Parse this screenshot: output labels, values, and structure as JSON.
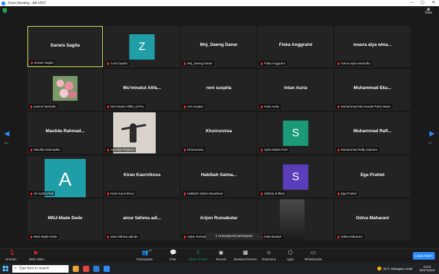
{
  "window": {
    "title": "Zoom Meeting - AA-VIII/7",
    "min": "—",
    "max": "▢",
    "close": "✕"
  },
  "topbar": {
    "view_label": "View",
    "view_icon": "grid"
  },
  "navigation": {
    "left_page": "1/2",
    "right_page": "1/2",
    "left_arrow": "◀",
    "right_arrow": "▶"
  },
  "tiles": [
    {
      "name": "Darwis Sagita",
      "label": "Darwis Sagita",
      "active": true
    },
    {
      "avatar": "Z",
      "avatar_color": "#1f9ea8",
      "label": "zoom baa04"
    },
    {
      "name": "Mnj_Daeng Danar",
      "label": "Mnj_Daeng Danar"
    },
    {
      "name": "Fiska Anggraini",
      "label": "Fiska Anggraini"
    },
    {
      "name": "maura alya wina...",
      "label": "maura alya winandha"
    },
    {
      "photo": "flowers",
      "label": "yasmin hamidah"
    },
    {
      "name": "Mu'minatul Alifa...",
      "label": "Mu'minatul Alifah_ILPOL"
    },
    {
      "name": "reni suspita",
      "label": "reni suspita"
    },
    {
      "name": "Intan Auria",
      "label": "Intan Auria"
    },
    {
      "name": "Muhammad Eka...",
      "label": "Muhammad Eka Nanda Putra Naser"
    },
    {
      "name": "Maulida Rahmad...",
      "label": "Maulida Rahmadini"
    },
    {
      "photo": "dance",
      "label": "Ayu Dwi Pratama"
    },
    {
      "name": "Khoirunnisa",
      "label": "Khoirunnisa"
    },
    {
      "avatar": "S",
      "avatar_color": "#1a9a78",
      "label": "Syifa Maitra Putri"
    },
    {
      "name": "Muhammad Rafl...",
      "label": "Muhammad Rafly Diantoro"
    },
    {
      "avatar": "A",
      "avatar_color": "#1f9ea8",
      "big": true,
      "label": "Afi Aprilia Putri"
    },
    {
      "name": "Kiran Kaurnikova",
      "label": "Kiran Kaurnikova"
    },
    {
      "name": "Habibah Salma...",
      "label": "Habibah Salma Banahsan"
    },
    {
      "avatar": "S",
      "avatar_color": "#5a3db8",
      "label": "Safrida Zulfiani"
    },
    {
      "name": "Ega Pratiwi",
      "label": "Ega Pratiwi"
    },
    {
      "name": "MNJ-Made Dede",
      "label": "MNJ-Made Dede"
    },
    {
      "name": "ainur fathma adi...",
      "label": "ainur fathma adinda"
    },
    {
      "name": "Arijon Rumabutar",
      "label": "Arijon Rumabutar"
    },
    {
      "photo": "dark",
      "label": "Intan Bestari"
    },
    {
      "name": "Odiva Maharani",
      "label": "Odiva Maharani"
    }
  ],
  "unassigned": "1 unassigned participant",
  "toolbar": {
    "unmute": "Unmute",
    "start_video": "Start Video",
    "participants": "Participants",
    "participants_count": "37",
    "chat": "Chat",
    "share_screen": "Share Screen",
    "record": "Record",
    "breakout_rooms": "Breakout Rooms",
    "reactions": "Reactions",
    "apps": "Apps",
    "whiteboards": "Whiteboards",
    "leave": "Leave Room"
  },
  "taskbar": {
    "search_placeholder": "Type here to search",
    "weather_temp": "31°C",
    "weather_text": "Sebagian cerah",
    "time": "13:01",
    "date": "03/27/2023"
  },
  "colors": {
    "accent": "#2d8cff",
    "active_border": "#d7e35a",
    "share_green": "#23a455"
  }
}
